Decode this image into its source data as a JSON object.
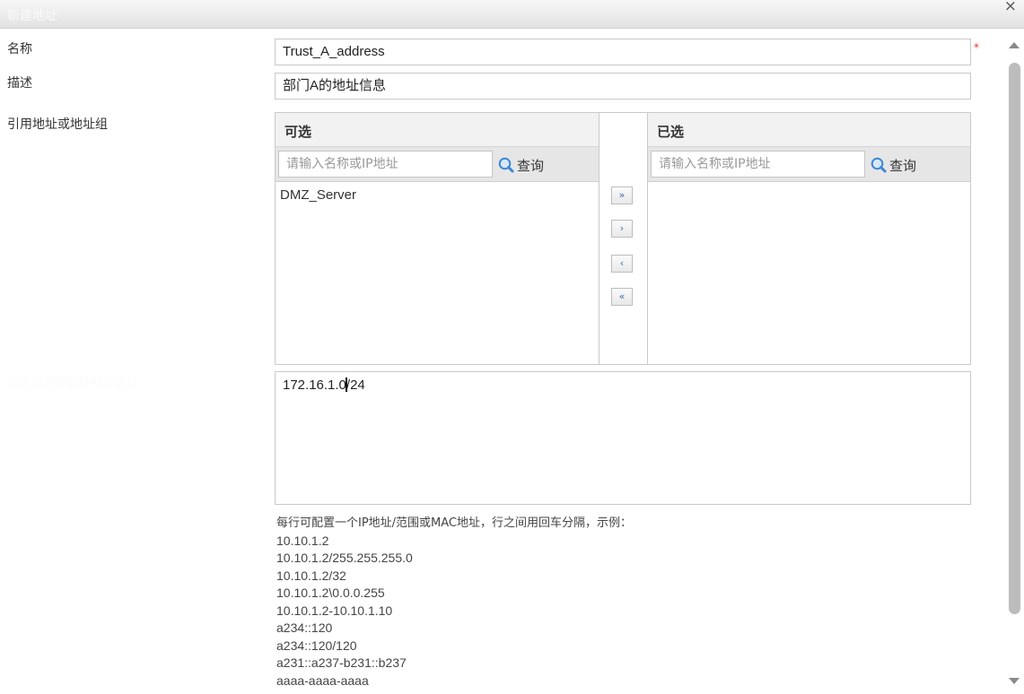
{
  "window": {
    "title": "新建地址",
    "close_symbol": "×"
  },
  "form": {
    "name_label": "名称",
    "name_value": "Trust_A_address",
    "required_mark": "*",
    "desc_label": "描述",
    "desc_value": "部门A的地址信息",
    "ref_label": "引用地址或地址组",
    "ip_label": "IP地址/范围或MAC地址"
  },
  "available": {
    "header": "可选",
    "search_placeholder": "请输入名称或IP地址",
    "search_button": "查询",
    "items": [
      "DMZ_Server"
    ]
  },
  "selected": {
    "header": "已选",
    "search_placeholder": "请输入名称或IP地址",
    "search_button": "查询",
    "items": []
  },
  "transfer_buttons": {
    "add_all": "»",
    "add": "›",
    "remove": "‹",
    "remove_all": "«"
  },
  "ip_textarea": {
    "value_before_caret": "172.16.1.0",
    "value_after_caret": "/24"
  },
  "help": {
    "intro": "每行可配置一个IP地址/范围或MAC地址，行之间用回车分隔，示例：",
    "examples": [
      "10.10.1.2",
      "10.10.1.2/255.255.255.0",
      "10.10.1.2/32",
      "10.10.1.2\\0.0.0.255",
      "10.10.1.2-10.10.1.10",
      "a234::120",
      "a234::120/120",
      "a231::a237-b231::b237",
      "aaaa-aaaa-aaaa"
    ]
  },
  "colors": {
    "accent_blue": "#3b6fb0",
    "required_red": "#e33333"
  },
  "icons": {
    "search": "magnifier-icon",
    "close": "close-icon"
  }
}
